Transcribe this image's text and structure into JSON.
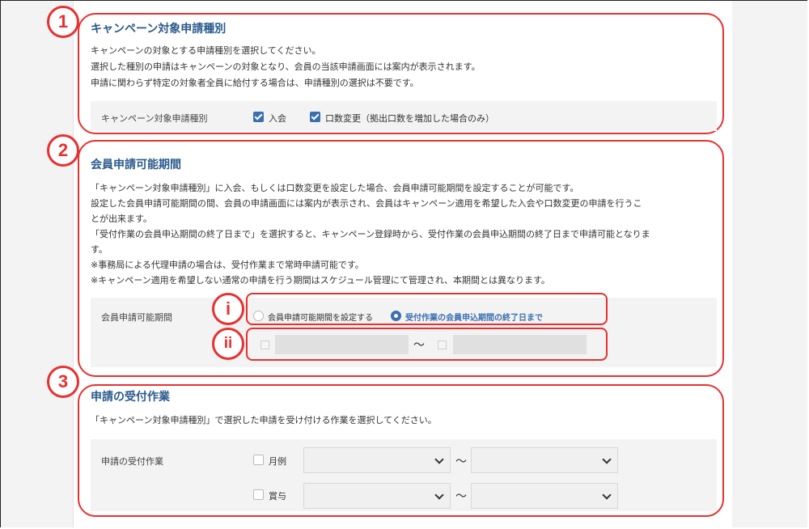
{
  "sections": {
    "s1": {
      "badge": "1",
      "title": "キャンペーン対象申請種別",
      "desc": [
        "キャンペーンの対象とする申請種別を選択してください。",
        "選択した種別の申請はキャンペーンの対象となり、会員の当該申請画面には案内が表示されます。",
        "申請に関わらず特定の対象者全員に給付する場合は、申請種別の選択は不要です。"
      ],
      "row_label": "キャンペーン対象申請種別",
      "options": [
        {
          "label": "入会",
          "checked": true
        },
        {
          "label": "口数変更（拠出口数を増加した場合のみ）",
          "checked": true
        }
      ]
    },
    "s2": {
      "badge": "2",
      "title": "会員申請可能期間",
      "desc": [
        "「キャンペーン対象申請種別」に入会、もしくは口数変更を設定した場合、会員申請可能期間を設定することが可能です。",
        "設定した会員申請可能期間の間、会員の申請画面には案内が表示され、会員はキャンペーン適用を希望した入会や口数変更の申請を行うこ",
        "とが出来ます。",
        "「受付作業の会員申込期間の終了日まで」を選択すると、キャンペーン登録時から、受付作業の会員申込期間の終了日まで申請可能となりま",
        "す。",
        "※事務局による代理申請の場合は、受付作業まで常時申請可能です。",
        "※キャンペーン適用を希望しない通常の申請を行う期間はスケジュール管理にて管理され、本期間とは異なります。"
      ],
      "row_label": "会員申請可能期間",
      "badge_i": "i",
      "badge_ii": "ii",
      "radio_options": [
        {
          "label": "会員申請可能期間を設定する",
          "selected": false
        },
        {
          "label": "受付作業の会員申込期間の終了日まで",
          "selected": true
        }
      ],
      "range_sep": "～"
    },
    "s3": {
      "badge": "3",
      "title": "申請の受付作業",
      "desc": [
        "「キャンペーン対象申請種別」で選択した申請を受け付ける作業を選択してください。"
      ],
      "row_label": "申請の受付作業",
      "items": [
        {
          "label": "月例",
          "checked": false
        },
        {
          "label": "賞与",
          "checked": false
        }
      ],
      "range_sep": "～"
    }
  },
  "colors": {
    "annotation": "#e8302f",
    "title": "#2b5a8c",
    "accent": "#3b6fb0"
  },
  "icons": [
    "checkbox-checked-icon",
    "checkbox-empty-icon",
    "radio-icon",
    "calendar-icon",
    "chevron-down-icon"
  ]
}
